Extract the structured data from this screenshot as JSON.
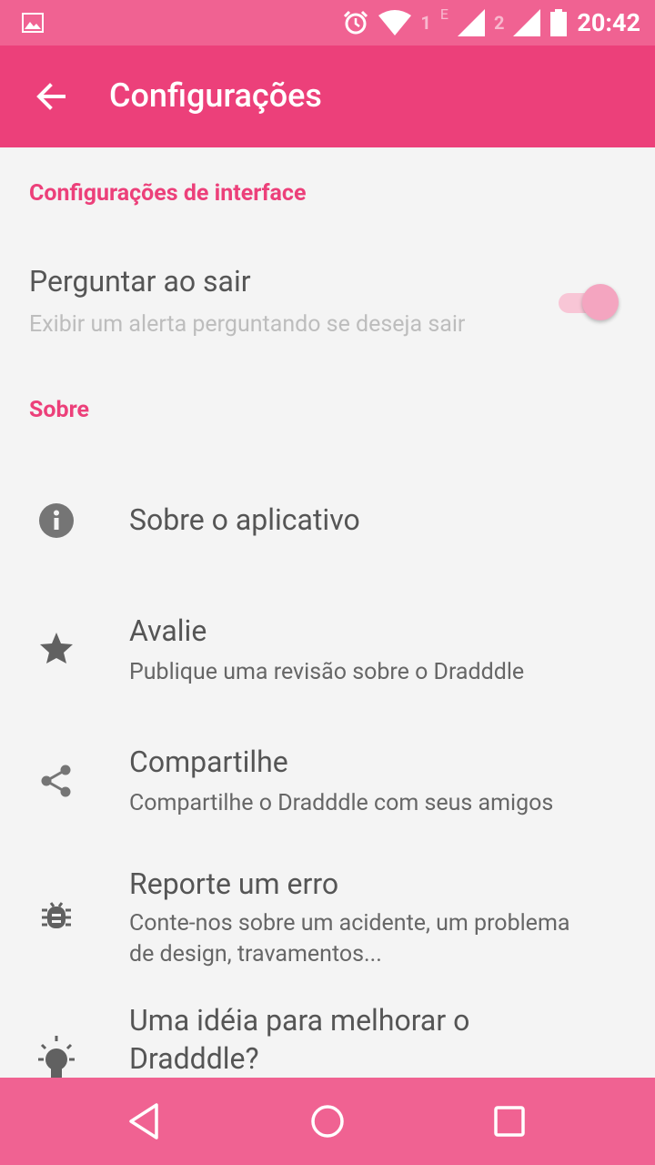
{
  "status_bar": {
    "sim1": "1",
    "network_type": "E",
    "sim2": "2",
    "time": "20:42"
  },
  "app_bar": {
    "title": "Configurações"
  },
  "sections": {
    "interface_header": "Configurações de interface",
    "about_header": "Sobre"
  },
  "ask_on_exit": {
    "title": "Perguntar ao sair",
    "subtitle": "Exibir um alerta perguntando se deseja sair",
    "enabled": true
  },
  "about_items": [
    {
      "icon": "info-icon",
      "title": "Sobre o aplicativo"
    },
    {
      "icon": "star-icon",
      "title": "Avalie",
      "subtitle": "Publique uma revisão sobre o Dradddle"
    },
    {
      "icon": "share-icon",
      "title": "Compartilhe",
      "subtitle": "Compartilhe o Dradddle com seus amigos"
    },
    {
      "icon": "bug-icon",
      "title": "Reporte um erro",
      "subtitle_line1": "Conte-nos sobre um acidente, um problema",
      "subtitle_line2": "de design, travamentos..."
    },
    {
      "icon": "lightbulb-icon",
      "title_line1": "Uma idéia para melhorar o",
      "title_line2": "Dradddle?"
    }
  ],
  "colors": {
    "status_bar": "#f06292",
    "app_bar": "#ec407a",
    "accent": "#ec407a",
    "nav_bar": "#f06292"
  }
}
